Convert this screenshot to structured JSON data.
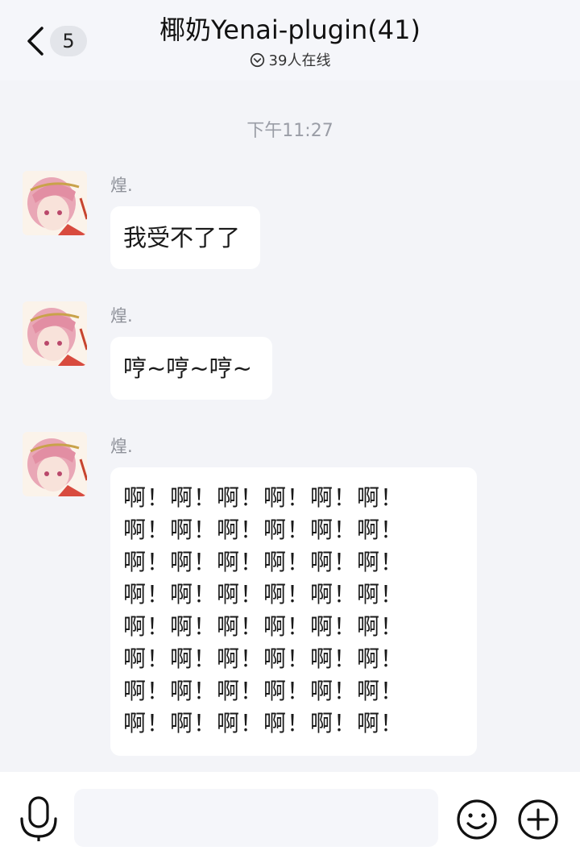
{
  "header": {
    "unread_count": "5",
    "title": "椰奶Yenai-plugin(41)",
    "online_status": "39人在线"
  },
  "chat": {
    "timestamp": "下午11:27",
    "messages": [
      {
        "sender": "煌.",
        "text": "我受不了了"
      },
      {
        "sender": "煌.",
        "text": "哼~哼~哼~"
      },
      {
        "sender": "煌.",
        "lines": [
          "啊！啊！啊！啊！啊！啊！",
          "啊！啊！啊！啊！啊！啊！",
          "啊！啊！啊！啊！啊！啊！",
          "啊！啊！啊！啊！啊！啊！",
          "啊！啊！啊！啊！啊！啊！",
          "啊！啊！啊！啊！啊！啊！",
          "啊！啊！啊！啊！啊！啊！",
          "啊！啊！啊！啊！啊！啊！"
        ]
      }
    ]
  },
  "icons": {
    "back": "chevron-left-icon",
    "online": "chevron-circle-down-icon",
    "voice": "microphone-icon",
    "emoji": "smiley-icon",
    "more": "plus-circle-icon"
  },
  "colors": {
    "background": "#f3f4f8",
    "bubble": "#ffffff",
    "badge": "#e3e5ea",
    "muted_text": "#9a9da6"
  }
}
